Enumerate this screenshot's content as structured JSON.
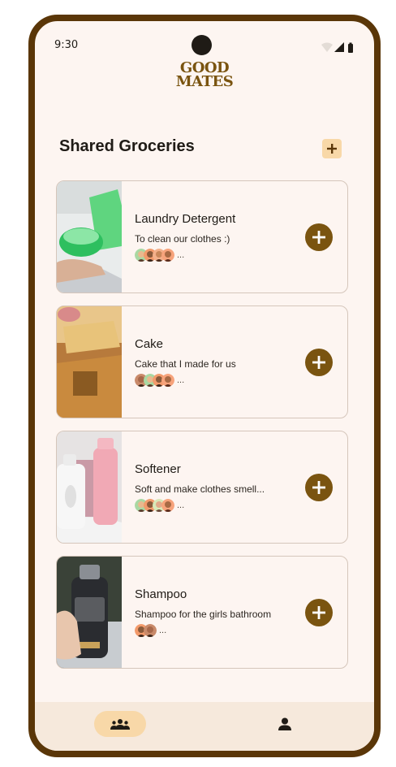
{
  "status_bar": {
    "time": "9:30"
  },
  "app": {
    "logo_line1": "GOOD",
    "logo_line2": "MATES"
  },
  "page": {
    "title": "Shared Groceries",
    "add_icon": "plus-icon"
  },
  "items": [
    {
      "name": "Laundry Detergent",
      "description": "To clean our clothes :)",
      "more": "..."
    },
    {
      "name": "Cake",
      "description": "Cake that I made for us",
      "more": "..."
    },
    {
      "name": "Softener",
      "description": "Soft and make clothes smell...",
      "more": "..."
    },
    {
      "name": "Shampoo",
      "description": "Shampoo for the girls bathroom",
      "more": "..."
    }
  ],
  "bottom_nav": {
    "items": [
      {
        "icon": "group-icon",
        "selected": true
      },
      {
        "icon": "person-icon",
        "selected": false
      }
    ]
  },
  "colors": {
    "frame": "#5a3608",
    "accent": "#7a5410",
    "accent_light": "#f8d8a8",
    "background": "#fdf5f1",
    "nav_background": "#f6e9dc"
  }
}
